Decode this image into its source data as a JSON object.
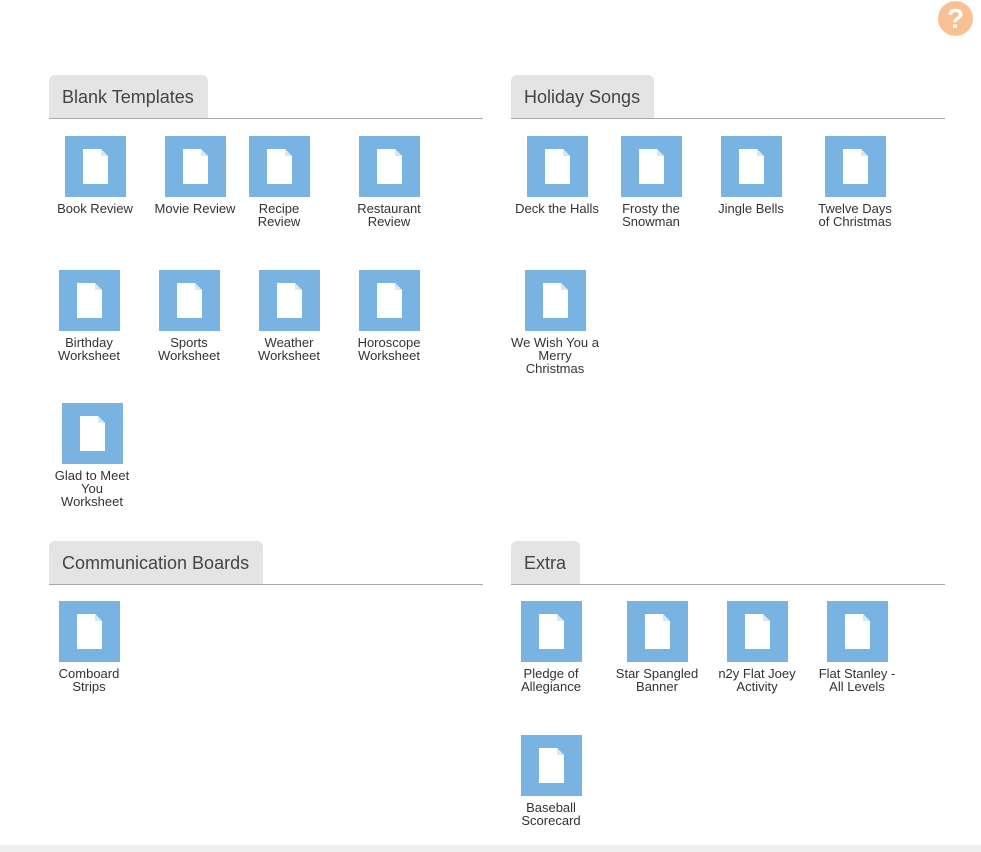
{
  "help": {
    "label": "?"
  },
  "sections": [
    {
      "title": "Blank Templates",
      "items": [
        {
          "label": "Book Review"
        },
        {
          "label": "Movie Review"
        },
        {
          "label": "Recipe Review"
        },
        {
          "label": "Restaurant Review"
        },
        {
          "label": "Birthday Worksheet"
        },
        {
          "label": "Sports Worksheet"
        },
        {
          "label": "Weather Worksheet"
        },
        {
          "label": "Horoscope Worksheet"
        },
        {
          "label": "Glad to Meet You Worksheet"
        }
      ]
    },
    {
      "title": "Holiday Songs",
      "items": [
        {
          "label": "Deck the Halls"
        },
        {
          "label": "Frosty the Snowman"
        },
        {
          "label": "Jingle Bells"
        },
        {
          "label": "Twelve Days of Christmas"
        },
        {
          "label": "We Wish You a Merry Christmas"
        }
      ]
    },
    {
      "title": "Communication Boards",
      "items": [
        {
          "label": "Comboard Strips"
        }
      ]
    },
    {
      "title": "Extra",
      "items": [
        {
          "label": "Pledge of Allegiance"
        },
        {
          "label": "Star Spangled Banner"
        },
        {
          "label": "n2y Flat Joey Activity"
        },
        {
          "label": "Flat Stanley - All Levels"
        },
        {
          "label": "Baseball Scorecard"
        }
      ]
    }
  ],
  "icons": {
    "help": "question-mark-icon",
    "document": "document-icon"
  },
  "colors": {
    "tile": "#79b3e2",
    "help": "#f9c193",
    "tab": "#e4e4e4"
  }
}
